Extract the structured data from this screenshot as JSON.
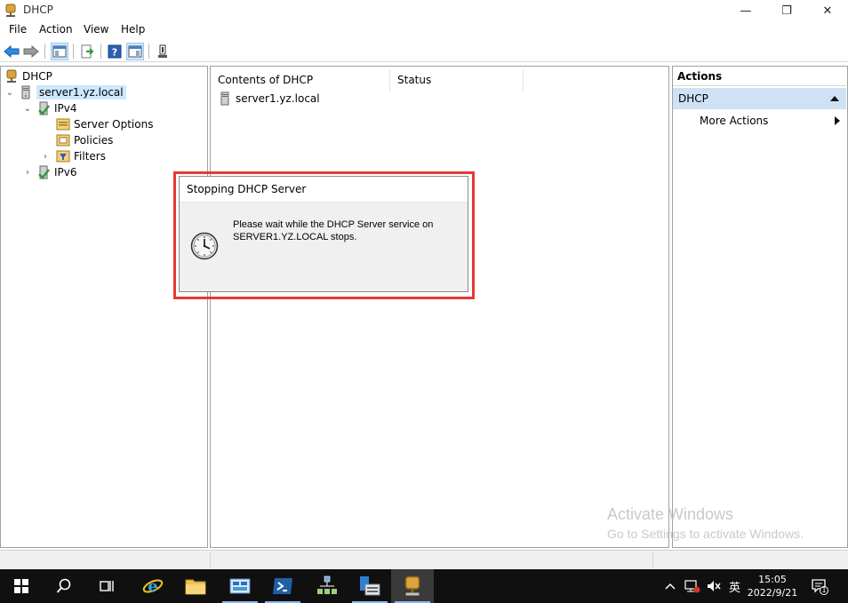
{
  "window": {
    "title": "DHCP",
    "minimize_glyph": "—",
    "restore_glyph": "❐",
    "close_glyph": "✕"
  },
  "menu": [
    "File",
    "Action",
    "View",
    "Help"
  ],
  "tree": {
    "root": "DHCP",
    "server": "server1.yz.local",
    "ipv4": "IPv4",
    "server_options": "Server Options",
    "policies": "Policies",
    "filters": "Filters",
    "ipv6": "IPv6"
  },
  "content": {
    "col_contents": "Contents of DHCP",
    "col_status": "Status",
    "row_name": "server1.yz.local"
  },
  "actions": {
    "header": "Actions",
    "section": "DHCP",
    "more": "More Actions"
  },
  "dialog": {
    "title": "Stopping DHCP Server",
    "line1": "Please wait while the DHCP Server service on",
    "line2": "SERVER1.YZ.LOCAL stops."
  },
  "watermark": {
    "line1": "Activate Windows",
    "line2": "Go to Settings to activate Windows."
  },
  "tray": {
    "ime": "英",
    "time": "15:05",
    "date": "2022/9/21",
    "notifications": "1"
  },
  "icons": {
    "back": "back-arrow-icon",
    "forward": "forward-arrow-icon",
    "accent": "#1f6fd1",
    "tree_highlight": "#cce8ff",
    "dialog_outline": "#e53935"
  }
}
